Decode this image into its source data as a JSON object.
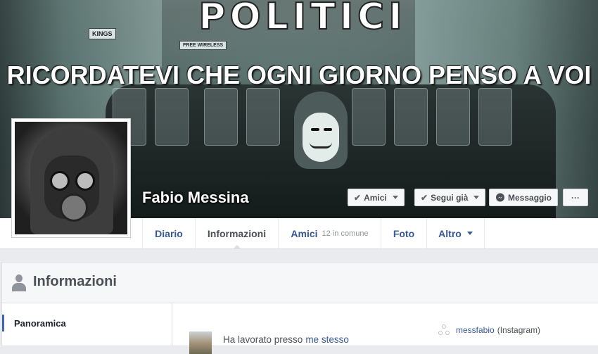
{
  "cover": {
    "title": "POLITICI",
    "subtitle": "RICORDATEVI CHE OGNI GIORNO PENSO A VOI",
    "signs": [
      "KINGS",
      "FREE WIRELESS"
    ]
  },
  "profile": {
    "name": "Fabio Messina",
    "avatar_icon": "gas-mask-icon"
  },
  "actions": {
    "friends_label": "Amici",
    "follow_label": "Segui già",
    "message_label": "Messaggio",
    "more_label": "···"
  },
  "nav": {
    "items": [
      {
        "label": "Diario"
      },
      {
        "label": "Informazioni"
      },
      {
        "label": "Amici",
        "sub": "12 in comune"
      },
      {
        "label": "Foto"
      },
      {
        "label": "Altro"
      }
    ]
  },
  "about": {
    "header": "Informazioni",
    "sidebar": [
      "Panoramica"
    ],
    "work_prefix": "Ha lavorato presso",
    "work_link": "me stesso",
    "instagram_user": "messfabio",
    "instagram_label": "(Instagram)"
  },
  "colors": {
    "link": "#365899",
    "accent": "#4267b2",
    "text": "#4b4f56"
  }
}
